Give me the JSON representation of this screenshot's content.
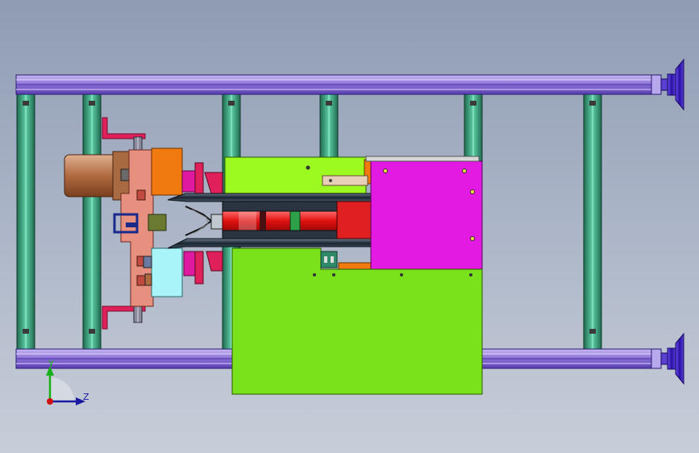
{
  "viewport": {
    "name": "cad-3d-viewport",
    "background_top": "#8f9cb3",
    "background_bottom": "#c8ced9"
  },
  "triad": {
    "y_label": "Y",
    "z_label": "Z",
    "y_color": "#18b018",
    "z_color": "#1a1aa0",
    "origin_color": "#d01010"
  },
  "colors": {
    "rail": "#8a6fd6",
    "post": "#2f8a6a",
    "leveling_foot": "#3a1fc0",
    "lime_panel": "#79e21a",
    "magenta_box": "#e21ae2",
    "orange_block": "#f07a10",
    "cyan_block": "#a8f4f8",
    "copper_motor": "#c07850",
    "red_rotor": "#e02020",
    "salmon_plate": "#e89080",
    "crimson_bracket": "#e0205a"
  },
  "icons": [
    "view-triad-icon",
    "leveling-foot-icon"
  ]
}
